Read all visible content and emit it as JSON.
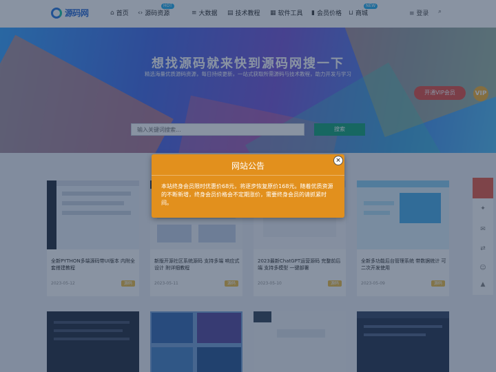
{
  "header": {
    "logo_text": "源码网",
    "nav": [
      {
        "label": "首页",
        "icon": "home-icon",
        "badge": ""
      },
      {
        "label": "源码资源",
        "icon": "code-icon",
        "badge": "HOT"
      },
      {
        "label": "大数据",
        "icon": "database-icon",
        "badge": ""
      },
      {
        "label": "技术教程",
        "icon": "book-icon",
        "badge": ""
      },
      {
        "label": "软件工具",
        "icon": "tool-icon",
        "badge": ""
      },
      {
        "label": "会员价格",
        "icon": "chart-icon",
        "badge": ""
      },
      {
        "label": "商城",
        "icon": "cart-icon",
        "badge": "NEW"
      }
    ],
    "login_label": "登录"
  },
  "hero": {
    "title": "想找源码就来快到源码网搜一下",
    "subtitle": "精选海量优质源码资源，每日持续更新，一站式获取所需源码与技术教程，助力开发与学习",
    "search_placeholder": "输入关键词搜索...",
    "search_button": "搜索",
    "vip_button": "开通VIP会员",
    "vip_icon": "VIP"
  },
  "cards_row1": [
    {
      "title": "全新PYTHON多端源码带UI版本 内附全套搭建教程",
      "meta": "2023-05-12",
      "tag": "源码"
    },
    {
      "title": "新版开源社区系统源码 支持多端 响应式设计 附详细教程",
      "meta": "2023-05-11",
      "tag": "源码"
    },
    {
      "title": "2023最新ChatGPT运营源码 完整前后端 支持多模型 一键部署",
      "meta": "2023-05-10",
      "tag": "源码"
    },
    {
      "title": "全新多功能后台管理系统 带数据统计 可二次开发使用",
      "meta": "2023-05-09",
      "tag": "源码"
    }
  ],
  "modal": {
    "title": "网站公告",
    "body": "本站终身会员限时优惠价68元，将逐步恢复原价168元。随着优质资源的不断新增，终身会员价格会不定期涨价，需要终身会员的请抓紧时间。",
    "close_label": "×"
  },
  "colors": {
    "modal_bg": "#e2901d",
    "accent": "#2f7de1",
    "search_button": "#1aa77c"
  }
}
